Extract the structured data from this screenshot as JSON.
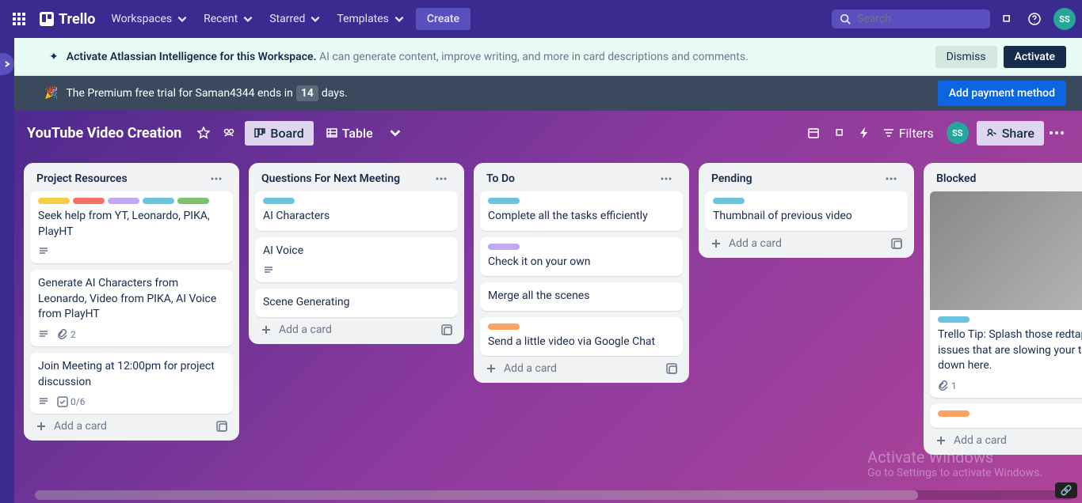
{
  "nav": {
    "logo": "Trello",
    "items": [
      "Workspaces",
      "Recent",
      "Starred",
      "Templates"
    ],
    "create": "Create",
    "search_placeholder": "Search",
    "avatar": "SS"
  },
  "banner_ai": {
    "bold": "Activate Atlassian Intelligence for this Workspace.",
    "text": " AI can generate content, improve writing, and more in card descriptions and comments.",
    "dismiss": "Dismiss",
    "activate": "Activate"
  },
  "banner_trial": {
    "prefix": "The Premium free trial for Saman4344 ends in ",
    "days": "14",
    "suffix": " days.",
    "button": "Add payment method"
  },
  "board": {
    "title": "YouTube Video Creation",
    "view_board": "Board",
    "view_table": "Table",
    "filters": "Filters",
    "avatar": "SS",
    "share": "Share"
  },
  "lists": [
    {
      "title": "Project Resources",
      "cards": [
        {
          "labels": [
            "yellow",
            "red",
            "purple",
            "sky",
            "green"
          ],
          "text": "Seek help from YT, Leonardo, PIKA, PlayHT",
          "badges": [
            "desc"
          ]
        },
        {
          "labels": [],
          "text": "Generate AI Characters from Leonardo, Video from PIKA, AI Voice from PlayHT",
          "badges": [
            "desc",
            "attach:2"
          ]
        },
        {
          "labels": [],
          "text": "Join Meeting at 12:00pm for project discussion",
          "badges": [
            "desc",
            "check:0/6"
          ]
        }
      ],
      "add": "Add a card"
    },
    {
      "title": "Questions For Next Meeting",
      "cards": [
        {
          "labels": [
            "sky"
          ],
          "text": "AI Characters",
          "badges": []
        },
        {
          "labels": [],
          "text": "AI Voice",
          "badges": [
            "desc"
          ]
        },
        {
          "labels": [],
          "text": "Scene Generating",
          "badges": []
        }
      ],
      "add": "Add a card"
    },
    {
      "title": "To Do",
      "cards": [
        {
          "labels": [
            "sky"
          ],
          "text": "Complete all the tasks efficiently",
          "badges": []
        },
        {
          "labels": [
            "purple"
          ],
          "text": "Check it on your own",
          "badges": []
        },
        {
          "labels": [],
          "text": "Merge all the scenes",
          "badges": []
        },
        {
          "labels": [
            "orange"
          ],
          "text": "Send a little video via Google Chat",
          "badges": []
        }
      ],
      "add": "Add a card"
    },
    {
      "title": "Pending",
      "cards": [
        {
          "labels": [
            "sky"
          ],
          "text": "Thumbnail of previous video",
          "badges": []
        }
      ],
      "add": "Add a card"
    },
    {
      "title": "Blocked",
      "cards": [
        {
          "image": true,
          "labels": [
            "sky"
          ],
          "text": "Trello Tip: Splash those redtape-heavy issues that are slowing your team down here.",
          "badges": [
            "attach:1"
          ]
        },
        {
          "labels": [
            "orange"
          ],
          "text": "",
          "badges": []
        }
      ],
      "add": "Add a card"
    }
  ],
  "watermark": {
    "title": "Activate Windows",
    "sub": "Go to Settings to activate Windows."
  }
}
